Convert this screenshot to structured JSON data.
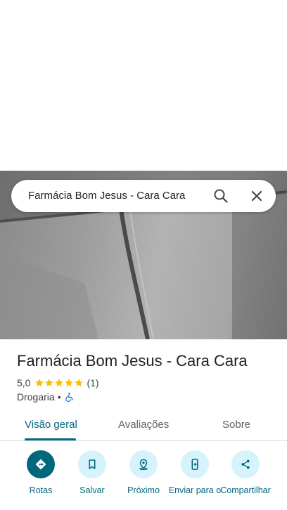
{
  "search": {
    "query": "Farmácia Bom Jesus - Cara Cara"
  },
  "place": {
    "name": "Farmácia Bom Jesus - Cara Cara",
    "rating": "5,0",
    "stars": 5,
    "review_count": "(1)",
    "category": "Drogaria",
    "separator": "•"
  },
  "tabs": [
    {
      "label": "Visão geral",
      "active": true
    },
    {
      "label": "Avaliações",
      "active": false
    },
    {
      "label": "Sobre",
      "active": false
    }
  ],
  "actions": [
    {
      "label": "Rotas",
      "icon": "directions-icon"
    },
    {
      "label": "Salvar",
      "icon": "bookmark-icon"
    },
    {
      "label": "Próximo",
      "icon": "nearby-icon"
    },
    {
      "label": "Enviar para o",
      "icon": "send-to-phone-icon"
    },
    {
      "label": "Compartilhar",
      "icon": "share-icon"
    }
  ],
  "colors": {
    "accent": "#00677d",
    "action_bg": "#d4f3fb",
    "star": "#fbbc04",
    "accessible_icon": "#1a73e8"
  }
}
